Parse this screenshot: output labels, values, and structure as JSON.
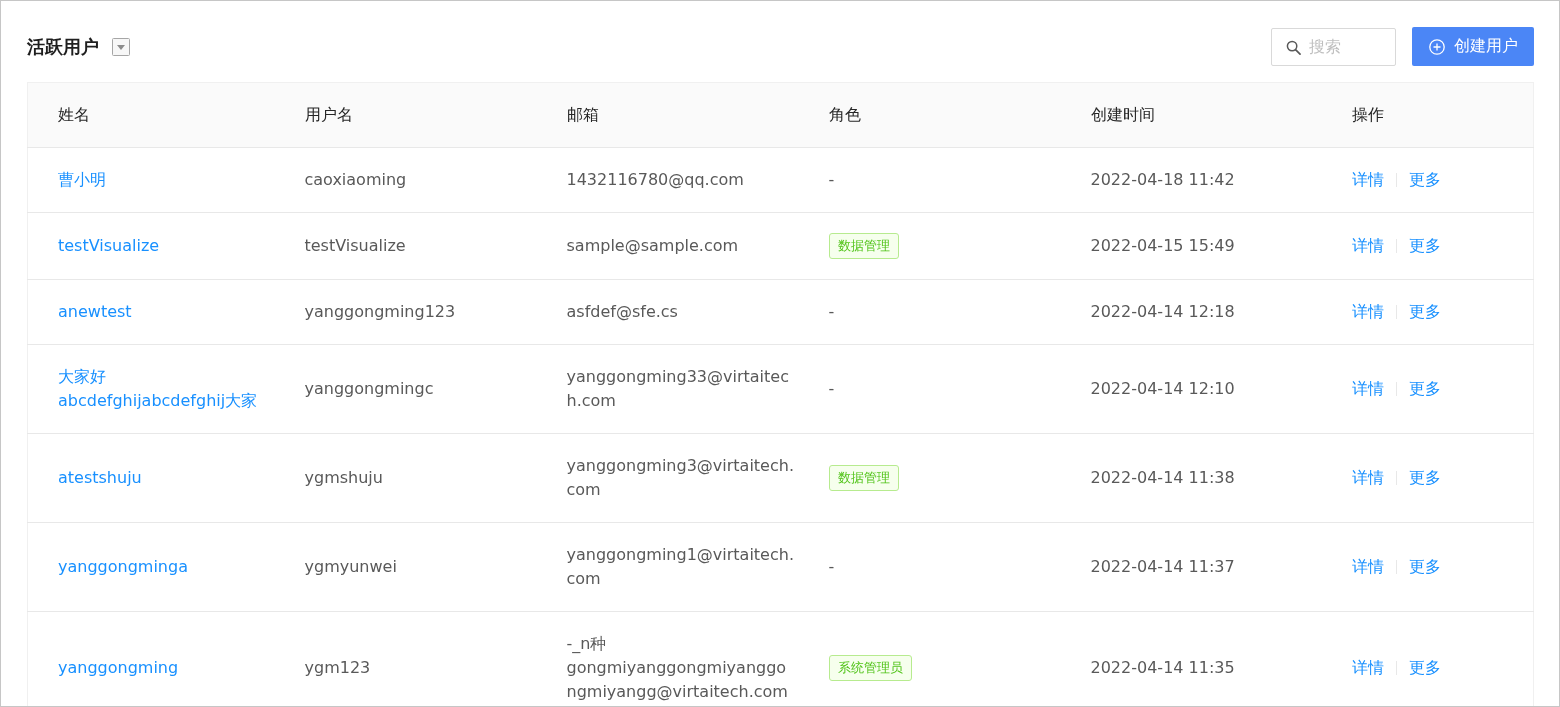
{
  "header": {
    "title": "活跃用户"
  },
  "search": {
    "placeholder": "搜索"
  },
  "create_button": {
    "label": "创建用户"
  },
  "table": {
    "columns": [
      "姓名",
      "用户名",
      "邮箱",
      "角色",
      "创建时间",
      "操作"
    ],
    "rows": [
      {
        "name": "曹小明",
        "username": "caoxiaoming",
        "email": "1432116780@qq.com",
        "role": {
          "kind": "text",
          "text": "-"
        },
        "created": "2022-04-18 11:42",
        "actions": [
          "详情",
          "更多"
        ]
      },
      {
        "name": "testVisualize",
        "username": "testVisualize",
        "email": "sample@sample.com",
        "role": {
          "kind": "tag",
          "text": "数据管理"
        },
        "created": "2022-04-15 15:49",
        "actions": [
          "详情",
          "更多"
        ]
      },
      {
        "name": "anewtest",
        "username": "yanggongming123",
        "email": "asfdef@sfe.cs",
        "role": {
          "kind": "text",
          "text": "-"
        },
        "created": "2022-04-14 12:18",
        "actions": [
          "详情",
          "更多"
        ]
      },
      {
        "name": "大家好abcdefghijabcdefghij大家",
        "username": "yanggongmingc",
        "email": "yanggongming33@virtaitech.com",
        "role": {
          "kind": "text",
          "text": "-"
        },
        "created": "2022-04-14 12:10",
        "actions": [
          "详情",
          "更多"
        ]
      },
      {
        "name": "atestshuju",
        "username": "ygmshuju",
        "email": "yanggongming3@virtaitech.com",
        "role": {
          "kind": "tag",
          "text": "数据管理"
        },
        "created": "2022-04-14 11:38",
        "actions": [
          "详情",
          "更多"
        ]
      },
      {
        "name": "yanggongminga",
        "username": "ygmyunwei",
        "email": "yanggongming1@virtaitech.com",
        "role": {
          "kind": "text",
          "text": "-"
        },
        "created": "2022-04-14 11:37",
        "actions": [
          "详情",
          "更多"
        ]
      },
      {
        "name": "yanggongming",
        "username": "ygm123",
        "email": "-_n种gongmiyanggongmiyanggongmiyangg@virtaitech.com",
        "role": {
          "kind": "tag",
          "text": "系统管理员"
        },
        "created": "2022-04-14 11:35",
        "actions": [
          "详情",
          "更多"
        ]
      }
    ]
  }
}
